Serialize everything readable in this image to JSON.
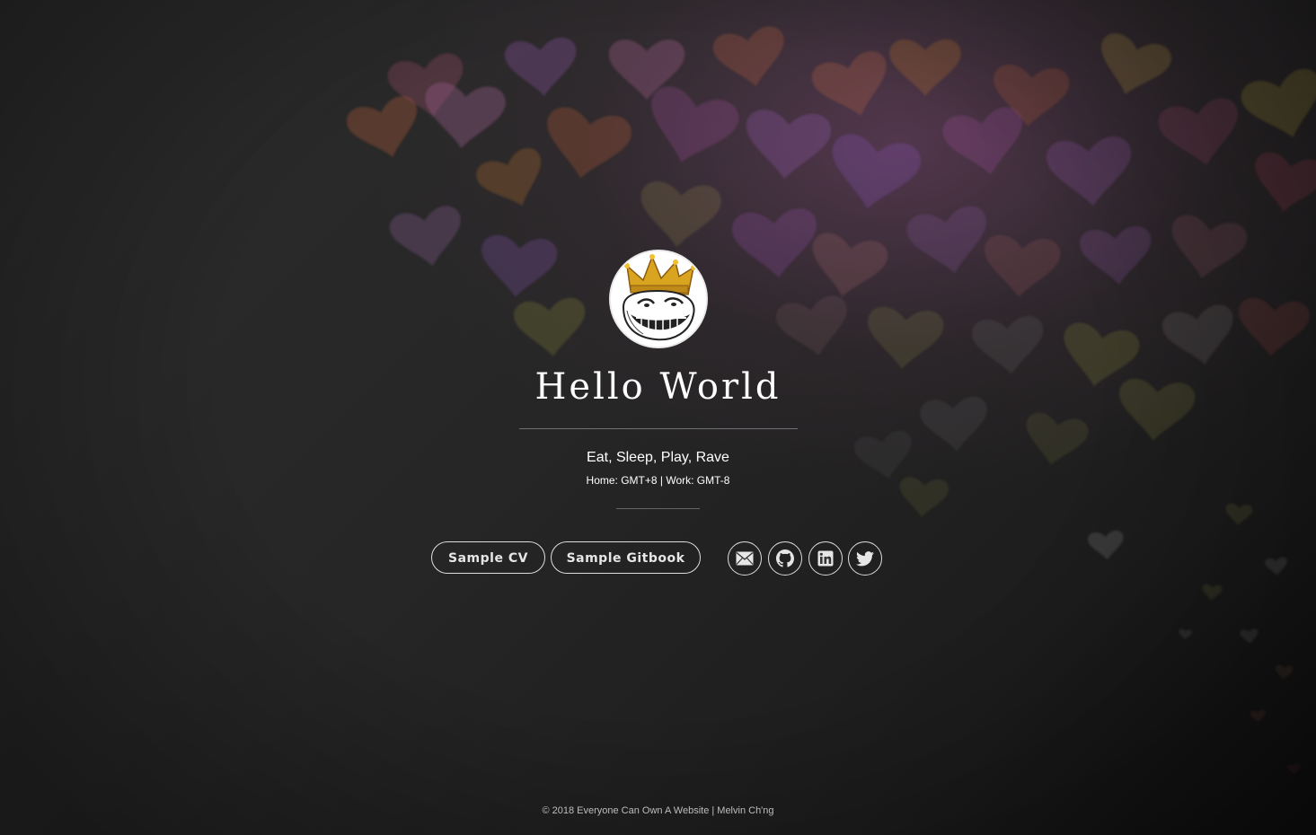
{
  "profile": {
    "title": "Hello World",
    "tagline": "Eat, Sleep, Play, Rave",
    "timezone": "Home: GMT+8 | Work: GMT-8"
  },
  "buttons": {
    "cv_label": "Sample CV",
    "gitbook_label": "Sample Gitbook"
  },
  "social": [
    {
      "icon": "mail-icon"
    },
    {
      "icon": "github-icon"
    },
    {
      "icon": "linkedin-icon"
    },
    {
      "icon": "twitter-icon"
    }
  ],
  "footer": {
    "text": "© 2018 Everyone Can Own A Website | Melvin Ch'ng"
  },
  "colors": {
    "background": "#232323",
    "text": "#ffffff",
    "footer_text": "#bdbdbd"
  }
}
